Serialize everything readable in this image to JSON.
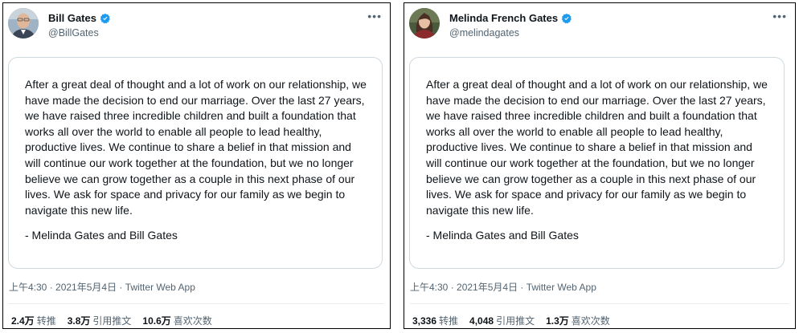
{
  "tweets": [
    {
      "display_name": "Bill Gates",
      "handle": "@BillGates",
      "statement": "After a great deal of thought and a lot of work on our relationship, we have made the decision to end our marriage. Over the last 27 years, we have raised three incredible children and built a foundation that works all over the world to enable all people to lead healthy, productive lives. We continue to share a belief in that mission and will continue our work together at the foundation, but we no longer believe we can grow together as a couple in this next phase of our lives. We ask for space and privacy for our family as we begin to navigate this new life.",
      "signature": "- Melinda Gates and Bill Gates",
      "timestamp": "上午4:30 · 2021年5月4日 · Twitter Web App",
      "stats": [
        {
          "num": "2.4万",
          "label": "转推"
        },
        {
          "num": "3.8万",
          "label": "引用推文"
        },
        {
          "num": "10.6万",
          "label": "喜欢次数"
        }
      ],
      "avatar_icon": "person-avatar-icon",
      "verified_color": "#1d9bf0"
    },
    {
      "display_name": "Melinda French Gates",
      "handle": "@melindagates",
      "statement": "After a great deal of thought and a lot of work on our relationship, we have made the decision to end our marriage. Over the last 27 years, we have raised three incredible children and built a foundation that works all over the world to enable all people to lead healthy, productive lives. We continue to share a belief in that mission and will continue our work together at the foundation, but we no longer believe we can grow together as a couple in this next phase of our lives. We ask for space and privacy for our family as we begin to navigate this new life.",
      "signature": "- Melinda Gates and Bill Gates",
      "timestamp": "上午4:30 · 2021年5月4日 · Twitter Web App",
      "stats": [
        {
          "num": "3,336",
          "label": "转推"
        },
        {
          "num": "4,048",
          "label": "引用推文"
        },
        {
          "num": "1.3万",
          "label": "喜欢次数"
        }
      ],
      "avatar_icon": "person-avatar-icon",
      "verified_color": "#1d9bf0"
    }
  ],
  "more_icon": "more-options-icon"
}
